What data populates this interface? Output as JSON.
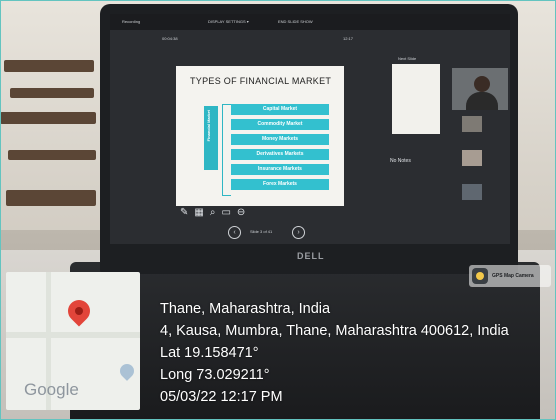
{
  "toolbar": {
    "left": "Recording",
    "settings": "DISPLAY SETTINGS ▾",
    "end": "END SLIDE SHOW"
  },
  "presenter": {
    "timer": "00:04:38",
    "clock": "12:17",
    "next_label": "Next Slide",
    "notes": "No Notes"
  },
  "slide": {
    "title": "TYPES OF FINANCIAL MARKET",
    "side_label": "Financial Market",
    "bars": [
      "Capital Market",
      "Commodity Market",
      "Money Markets",
      "Derivatives Markets",
      "Insurance Markets",
      "Forex Markets"
    ],
    "counter": "Slide 3 of 41"
  },
  "geo": {
    "badge": "GPS Map Camera",
    "map_brand": "Google",
    "lines": [
      "Thane, Maharashtra, India",
      "4, Kausa, Mumbra, Thane, Maharashtra 400612, India",
      "Lat 19.158471°",
      "Long 73.029211°",
      "05/03/22 12:17 PM"
    ]
  },
  "colors": {
    "accent": "#33c0cf",
    "pin": "#e2453a"
  }
}
